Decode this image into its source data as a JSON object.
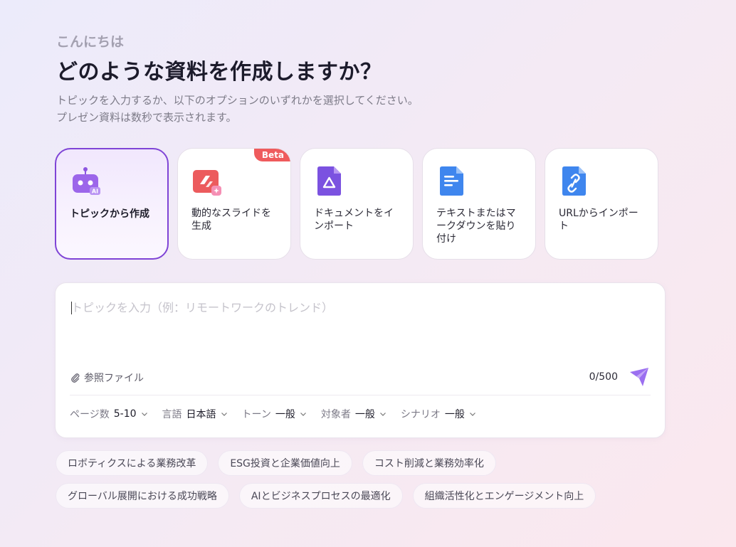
{
  "header": {
    "greeting": "こんにちは",
    "title": "どのような資料を作成しますか？",
    "subtitle_line1": "トピックを入力するか、以下のオプションのいずれかを選択してください。",
    "subtitle_line2": "プレゼン資料は数秒で表示されます。"
  },
  "cards": [
    {
      "label": "トピックから作成",
      "icon": "robot-ai-icon",
      "active": true
    },
    {
      "label": "動的なスライドを生成",
      "icon": "dynamic-slides-icon",
      "badge": "Beta"
    },
    {
      "label": "ドキュメントをインポート",
      "icon": "google-drive-doc-icon"
    },
    {
      "label": "テキストまたはマークダウンを貼り付け",
      "icon": "text-document-icon"
    },
    {
      "label": "URLからインポート",
      "icon": "link-document-icon"
    }
  ],
  "input": {
    "placeholder": "トピックを入力（例：リモートワークのトレンド）",
    "value": "",
    "attach_label": "参照ファイル",
    "counter": "0/500"
  },
  "options": [
    {
      "key": "ページ数",
      "value": "5-10"
    },
    {
      "key": "言語",
      "value": "日本語"
    },
    {
      "key": "トーン",
      "value": "一般"
    },
    {
      "key": "対象者",
      "value": "一般"
    },
    {
      "key": "シナリオ",
      "value": "一般"
    }
  ],
  "suggestions_row1": [
    "ロボティクスによる業務改革",
    "ESG投資と企業価値向上",
    "コスト削減と業務効率化"
  ],
  "suggestions_row2": [
    "グローバル展開における成功戦略",
    "AIとビジネスプロセスの最適化",
    "組織活性化とエンゲージメント向上"
  ],
  "colors": {
    "accent": "#7f44d6",
    "beta": "#ef5b5d",
    "send": "#9b6ff0"
  }
}
